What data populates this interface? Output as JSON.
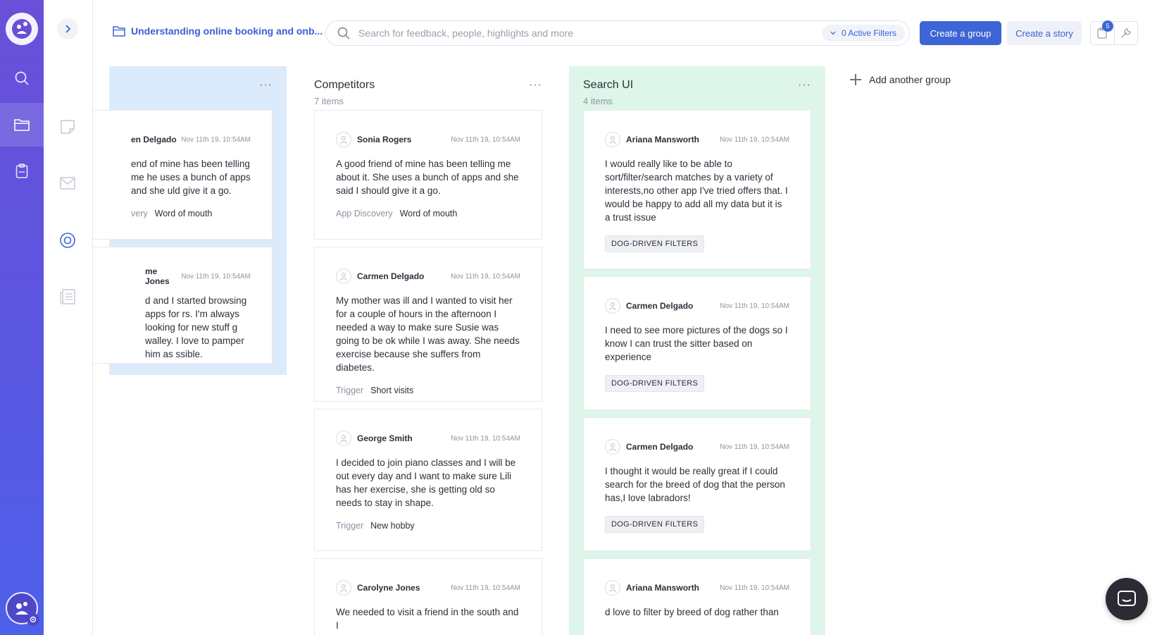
{
  "project": {
    "title": "Understanding online booking and onb..."
  },
  "search": {
    "placeholder": "Search for feedback, people, highlights and more",
    "filters_label": "0 Active Filters"
  },
  "actions": {
    "create_group": "Create a group",
    "create_story": "Create a story",
    "notifications_count": "5"
  },
  "columns": [
    {
      "title": "",
      "count": "",
      "bg": "#dcebfb",
      "cards": [
        {
          "person": "en Delgado",
          "date": "Nov 11th 19, 10:54AM",
          "quote": "end of mine has been telling me he uses a bunch of apps and she uld give it a go.",
          "tag_key": "very",
          "tag_value": "Word of mouth"
        },
        {
          "person": "me Jones",
          "date": "Nov 11th 19, 10:54AM",
          "quote": "d and I started browsing apps for rs. I'm always looking for new stuff g walley. I love to pamper him as ssible."
        }
      ]
    },
    {
      "title": "Competitors",
      "count": "7 items",
      "bg": "#ffffff",
      "cards": [
        {
          "person": "Sonia Rogers",
          "date": "Nov 11th 19, 10:54AM",
          "quote": "A good friend of mine has been telling me about it. She uses a bunch of apps and she said I should give it a go.",
          "tag_key": "App Discovery",
          "tag_value": "Word of mouth"
        },
        {
          "person": "Carmen Delgado",
          "date": "Nov 11th 19, 10:54AM",
          "quote": "My mother was ill and I wanted to visit her for a couple of hours in the afternoon I needed a way to make sure Susie was going to be ok while I was away. She needs exercise because she suffers from diabetes.",
          "tag_key": "Trigger",
          "tag_value": "Short visits"
        },
        {
          "person": "George Smith",
          "date": "Nov 11th 19, 10:54AM",
          "quote": "I decided to join piano classes and I will be out every day and I want to make sure Lili has her exercise, she is getting old so needs to stay in shape.",
          "tag_key": "Trigger",
          "tag_value": "New hobby"
        },
        {
          "person": "Carolyne Jones",
          "date": "Nov 11th 19, 10:54AM",
          "quote": "We needed to visit a friend in the south and I"
        }
      ]
    },
    {
      "title": "Search UI",
      "count": "4 items",
      "bg": "#ddf6e9",
      "cards": [
        {
          "person": "Ariana Mansworth",
          "date": "Nov 11th 19, 10:54AM",
          "quote": "I would really like to be able to sort/filter/search matches by a variety of interests,no other app I've tried offers that. I would be happy to add all my data but it is a trust issue",
          "chip": "DOG-DRIVEN FILTERS"
        },
        {
          "person": "Carmen Delgado",
          "date": "Nov 11th 19, 10:54AM",
          "quote": "I need to see more pictures of the dogs so I know I can trust the sitter based on experience",
          "chip": "DOG-DRIVEN FILTERS"
        },
        {
          "person": "Carmen Delgado",
          "date": "Nov 11th 19, 10:54AM",
          "quote": "I thought it would be really great if I could search for the breed of dog that the person has,I love labradors!",
          "chip": "DOG-DRIVEN FILTERS"
        },
        {
          "person": "Ariana Mansworth",
          "date": "Nov 11th 19, 10:54AM",
          "quote": "d love to filter by breed of dog rather than"
        }
      ]
    }
  ],
  "add_group_label": "Add another group",
  "column_menu_glyph": "···",
  "colors": {
    "accent": "#3d65d6",
    "rail_top": "#6a4fd8",
    "rail_bottom": "#4d60ea"
  }
}
